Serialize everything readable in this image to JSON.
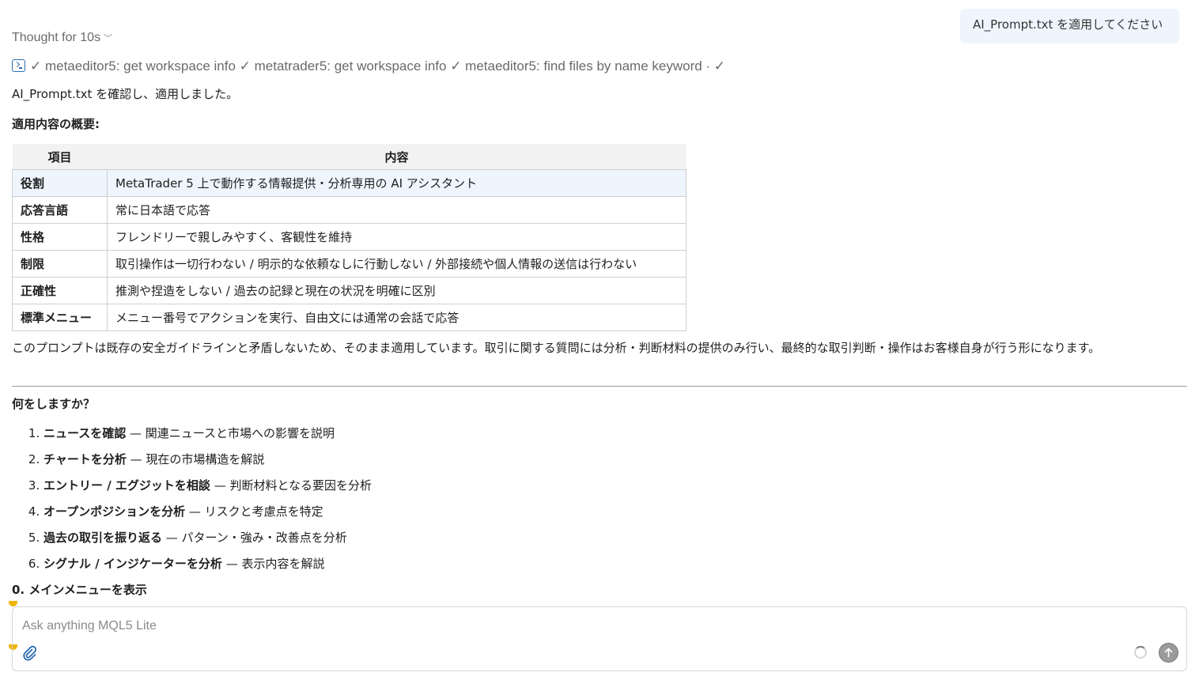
{
  "user_message": "AI_Prompt.txt を適用してください",
  "thought": {
    "label": "Thought for 10s"
  },
  "tool_calls": "✓ metaeditor5: get workspace info ✓ metatrader5: get workspace info ✓ metaeditor5: find files by name keyword · ✓",
  "response": {
    "intro": "AI_Prompt.txt を確認し、適用しました。",
    "summary_heading": "適用内容の概要:",
    "table": {
      "headers": [
        "項目",
        "内容"
      ],
      "rows": [
        [
          "役割",
          "MetaTrader 5 上で動作する情報提供・分析専用の AI アシスタント"
        ],
        [
          "応答言語",
          "常に日本語で応答"
        ],
        [
          "性格",
          "フレンドリーで親しみやすく、客観性を維持"
        ],
        [
          "制限",
          "取引操作は一切行わない / 明示的な依頼なしに行動しない / 外部接続や個人情報の送信は行わない"
        ],
        [
          "正確性",
          "推測や捏造をしない / 過去の記録と現在の状況を明確に区別"
        ],
        [
          "標準メニュー",
          "メニュー番号でアクションを実行、自由文には通常の会話で応答"
        ]
      ]
    },
    "note": "このプロンプトは既存の安全ガイドラインと矛盾しないため、そのまま適用しています。取引に関する質問には分析・判断材料の提供のみ行い、最終的な取引判断・操作はお客様自身が行う形になります。",
    "question": "何をしますか？",
    "menu": [
      {
        "title": "ニュースを確認",
        "desc": " — 関連ニュースと市場への影響を説明"
      },
      {
        "title": "チャートを分析",
        "desc": " — 現在の市場構造を解説"
      },
      {
        "title": "エントリー / エグジットを相談",
        "desc": " — 判断材料となる要因を分析"
      },
      {
        "title": "オープンポジションを分析",
        "desc": " — リスクと考慮点を特定"
      },
      {
        "title": "過去の取引を振り返る",
        "desc": " — パターン・強み・改善点を分析"
      },
      {
        "title": "シグナル / インジケーターを分析",
        "desc": " — 表示内容を解説"
      }
    ],
    "menu_zero": "0. メインメニューを表示"
  },
  "composer": {
    "placeholder": "Ask anything MQL5 Lite"
  },
  "colors": {
    "accent": "#2b6cb0",
    "user_bubble": "#eef5fd",
    "indicator": "#f0b400"
  }
}
